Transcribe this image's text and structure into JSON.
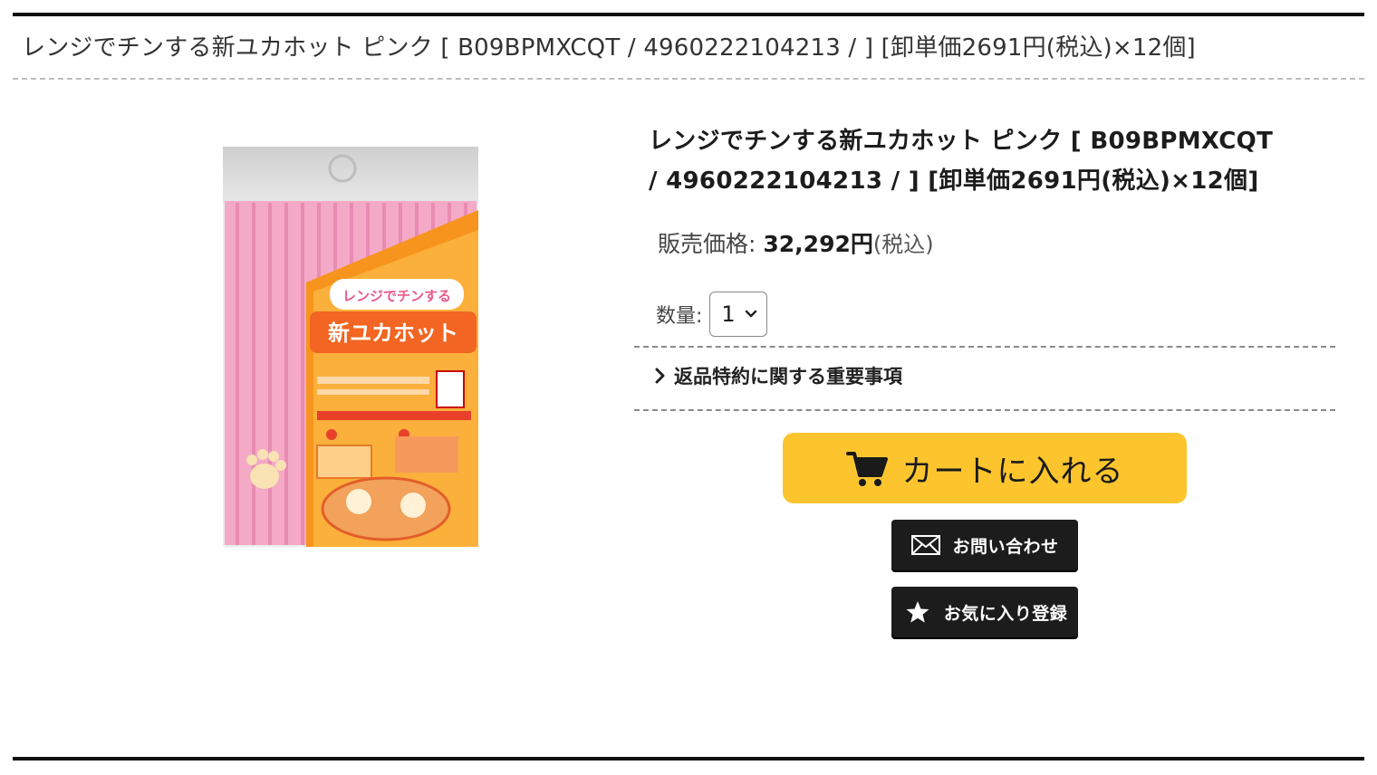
{
  "page": {
    "heading": "レンジでチンする新ユカホット ピンク [ B09BPMXCQT / 4960222104213 / ] [卸単価2691円(税込)×12個]"
  },
  "product": {
    "title": "レンジでチンする新ユカホット ピンク [ B09BPMXCQT / 4960222104213 / ] [卸単価2691円(税込)×12個]",
    "image_alt": "新ユカホット ピンク 商品画像",
    "package_text": {
      "tagline": "レンジでチンする",
      "brand": "新ユカホット"
    }
  },
  "price": {
    "label": "販売価格:",
    "value": "32,292円",
    "tax_note": "(税込)"
  },
  "quantity": {
    "label": "数量:",
    "selected": "1"
  },
  "returns_link": {
    "label": "返品特約に関する重要事項"
  },
  "buttons": {
    "cart": "カートに入れる",
    "contact": "お問い合わせ",
    "favorite": "お気に入り登録"
  },
  "colors": {
    "cart_button": "#fcc52e",
    "dark_button": "#1c1c1c",
    "rule": "#111111"
  },
  "icons": {
    "cart": "cart-icon",
    "contact": "mail-icon",
    "favorite": "star-icon",
    "returns": "chevron-right-icon",
    "select": "chevron-down-icon"
  }
}
